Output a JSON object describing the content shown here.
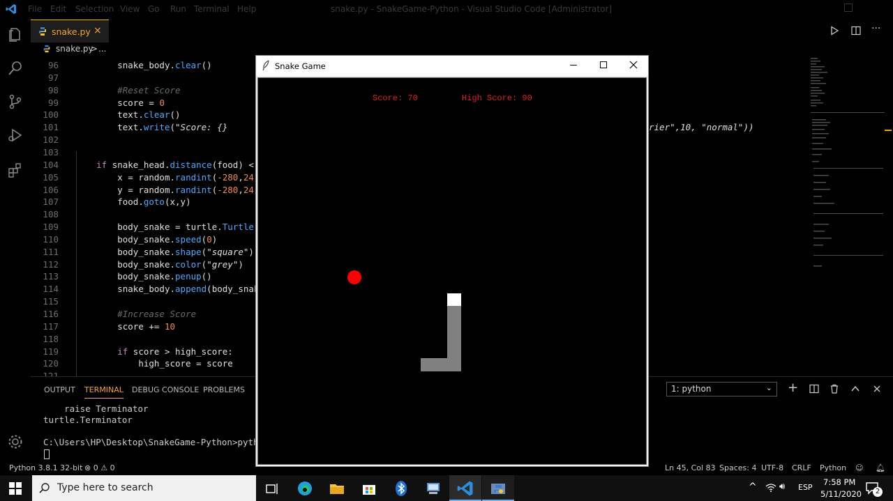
{
  "window": {
    "menu": [
      "File",
      "Edit",
      "Selection",
      "View",
      "Go",
      "Run",
      "Terminal",
      "Help"
    ],
    "title": "snake.py - SnakeGame-Python - Visual Studio Code [Administrator]"
  },
  "tab": {
    "filename": "snake.py",
    "close": "×"
  },
  "breadcrumb": {
    "file": "snake.py",
    "sep": ">",
    "rest": "..."
  },
  "editor_lines": [
    {
      "n": "96",
      "html": "        <span class='pl'>snake_body.</span><span class='fn'>clear</span><span class='pl'>()</span>"
    },
    {
      "n": "97",
      "html": ""
    },
    {
      "n": "98",
      "html": "        <span class='cm'>#Reset Score</span>"
    },
    {
      "n": "99",
      "html": "        <span class='pl'>score = </span><span class='num'>0</span>"
    },
    {
      "n": "100",
      "html": "        <span class='pl'>text.</span><span class='fn'>clear</span><span class='pl'>()</span>"
    },
    {
      "n": "101",
      "html": "        <span class='pl'>text.</span><span class='fn'>write</span><span class='pl'>(</span><span class='str'>\"Score: {}</span>"
    },
    {
      "n": "102",
      "html": ""
    },
    {
      "n": "103",
      "html": ""
    },
    {
      "n": "104",
      "html": "    <span class='kw'>if</span><span class='pl'> snake_head.</span><span class='fn'>distance</span><span class='pl'>(food) &lt;</span>"
    },
    {
      "n": "105",
      "html": "        <span class='pl'>x = random.</span><span class='fn'>randint</span><span class='pl'>(</span><span class='num'>-280</span><span class='pl'>,</span><span class='num'>24</span>"
    },
    {
      "n": "106",
      "html": "        <span class='pl'>y = random.</span><span class='fn'>randint</span><span class='pl'>(</span><span class='num'>-280</span><span class='pl'>,</span><span class='num'>24</span>"
    },
    {
      "n": "107",
      "html": "        <span class='pl'>food.</span><span class='fn'>goto</span><span class='pl'>(x,y)</span>"
    },
    {
      "n": "108",
      "html": ""
    },
    {
      "n": "109",
      "html": "        <span class='pl'>body_snake = turtle.</span><span class='fn'>Turtle</span>"
    },
    {
      "n": "110",
      "html": "        <span class='pl'>body_snake.</span><span class='fn'>speed</span><span class='pl'>(</span><span class='num'>0</span><span class='pl'>)</span>"
    },
    {
      "n": "111",
      "html": "        <span class='pl'>body_snake.</span><span class='fn'>shape</span><span class='pl'>(</span><span class='str'>\"square\"</span><span class='pl'>)</span>"
    },
    {
      "n": "112",
      "html": "        <span class='pl'>body_snake.</span><span class='fn'>color</span><span class='pl'>(</span><span class='str'>\"grey\"</span><span class='pl'>)</span>"
    },
    {
      "n": "113",
      "html": "        <span class='pl'>body_snake.</span><span class='fn'>penup</span><span class='pl'>()</span>"
    },
    {
      "n": "114",
      "html": "        <span class='pl'>snake_body.</span><span class='fn'>append</span><span class='pl'>(body_snak</span>"
    },
    {
      "n": "115",
      "html": ""
    },
    {
      "n": "116",
      "html": "        <span class='cm'>#Increase Score</span>"
    },
    {
      "n": "117",
      "html": "        <span class='pl'>score += </span><span class='num'>10</span>"
    },
    {
      "n": "118",
      "html": ""
    },
    {
      "n": "119",
      "html": "        <span class='kw'>if</span><span class='pl'> score &gt; high_score:</span>"
    },
    {
      "n": "120",
      "html": "            <span class='pl'>high_score = score</span>"
    },
    {
      "n": "121",
      "html": ""
    }
  ],
  "editor_overflow": {
    "text": "rier\",10, \"normal\"))"
  },
  "panel": {
    "tabs": [
      "OUTPUT",
      "TERMINAL",
      "DEBUG CONSOLE",
      "PROBLEMS"
    ],
    "terminal_select": "1: python",
    "terminal_lines": [
      "    raise Terminator",
      "turtle.Terminator",
      "",
      "C:\\Users\\HP\\Desktop\\SnakeGame-Python>pyth",
      ""
    ]
  },
  "statusbar": {
    "python": "Python 3.8.1 32-bit",
    "problems": "⊗ 0 ⚠ 0",
    "position": "Ln 45, Col 83",
    "spaces": "Spaces: 4",
    "encoding": "UTF-8",
    "eol": "CRLF",
    "language": "Python"
  },
  "snake_window": {
    "title": "Snake Game",
    "score": "Score: 70",
    "high_score": "High Score: 90"
  },
  "taskbar": {
    "search_placeholder": "Type here to search",
    "lang": "ESP",
    "time": "7:58 PM",
    "date": "5/11/2020",
    "notifications": "2"
  },
  "colors": {
    "accent": "#f5a623",
    "food": "#ff0000",
    "snake_head": "#ffffff",
    "snake_body": "#808080",
    "score_text": "#e02020"
  }
}
